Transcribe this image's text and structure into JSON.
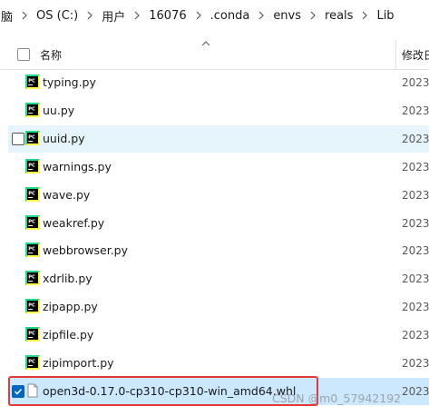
{
  "breadcrumb": [
    "脑",
    "OS (C:)",
    "用户",
    "16076",
    ".conda",
    "envs",
    "reals",
    "Lib"
  ],
  "header": {
    "name_label": "名称",
    "date_label": "修改日"
  },
  "files": [
    {
      "name": "typing.py",
      "date": "2023/",
      "type": "pycharm"
    },
    {
      "name": "uu.py",
      "date": "2023/",
      "type": "pycharm"
    },
    {
      "name": "uuid.py",
      "date": "2023/",
      "type": "pycharm",
      "state": "hover"
    },
    {
      "name": "warnings.py",
      "date": "2023/",
      "type": "pycharm"
    },
    {
      "name": "wave.py",
      "date": "2023/",
      "type": "pycharm"
    },
    {
      "name": "weakref.py",
      "date": "2023/",
      "type": "pycharm"
    },
    {
      "name": "webbrowser.py",
      "date": "2023/",
      "type": "pycharm"
    },
    {
      "name": "xdrlib.py",
      "date": "2023/",
      "type": "pycharm"
    },
    {
      "name": "zipapp.py",
      "date": "2023/",
      "type": "pycharm"
    },
    {
      "name": "zipfile.py",
      "date": "2023/",
      "type": "pycharm"
    },
    {
      "name": "zipimport.py",
      "date": "2023/",
      "type": "pycharm"
    },
    {
      "name": "open3d-0.17.0-cp310-cp310-win_amd64.whl",
      "date": "2023/",
      "type": "file",
      "state": "selected"
    }
  ],
  "watermark": "CSDN @m0_57942192",
  "colors": {
    "selected": "#cce8ff",
    "hover": "#e5f3fb",
    "accent": "#0067c0",
    "highlight": "#e53935"
  }
}
